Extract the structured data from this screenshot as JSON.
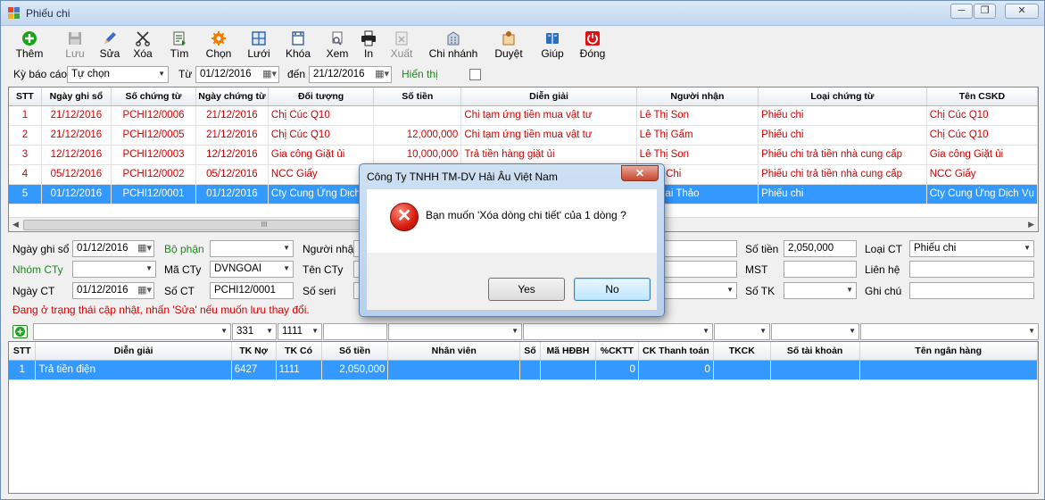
{
  "window": {
    "title": "Phiếu chi",
    "minimize": "─",
    "restore": "❐",
    "close": "✕"
  },
  "toolbar": [
    {
      "label": "Thêm",
      "icon": "add-icon",
      "color": "#1aa31a",
      "disabled": false
    },
    {
      "label": "Lưu",
      "icon": "save-icon",
      "color": "#8a8a8a",
      "disabled": true
    },
    {
      "label": "Sửa",
      "icon": "pencil-icon",
      "color": "#3a6fc4",
      "disabled": false
    },
    {
      "label": "Xóa",
      "icon": "scissors-icon",
      "color": "#333333",
      "disabled": false
    },
    {
      "label": "Tìm",
      "icon": "find-icon",
      "color": "#2b7a2b",
      "disabled": false
    },
    {
      "label": "Chọn",
      "icon": "gear-icon",
      "color": "#f07c00",
      "disabled": false
    },
    {
      "label": "Lưới",
      "icon": "grid-icon",
      "color": "#2a5fb0",
      "disabled": false
    },
    {
      "label": "Khóa",
      "icon": "lock-icon",
      "color": "#3a5fa0",
      "disabled": false
    },
    {
      "label": "Xem",
      "icon": "preview-icon",
      "color": "#5a5a8a",
      "disabled": false
    },
    {
      "label": "In",
      "icon": "printer-icon",
      "color": "#222222",
      "disabled": false
    },
    {
      "label": "Xuất",
      "icon": "export-icon",
      "color": "#9a9a9a",
      "disabled": true
    },
    {
      "label": "Chi nhánh",
      "icon": "building-icon",
      "color": "#5a6e8a",
      "disabled": false
    },
    {
      "label": "Duyệt",
      "icon": "approve-icon",
      "color": "#b06a1a",
      "disabled": false
    },
    {
      "label": "Giúp",
      "icon": "help-icon",
      "color": "#2b6fc0",
      "disabled": false
    },
    {
      "label": "Đóng",
      "icon": "power-icon",
      "color": "#e01010",
      "disabled": false
    }
  ],
  "filter": {
    "period_label": "Kỳ báo cáo",
    "period_value": "Tự chọn",
    "from_label": "Từ",
    "from_value": "01/12/2016",
    "to_label": "đến",
    "to_value": "21/12/2016",
    "show_label": "Hiển thị"
  },
  "master_grid": {
    "columns": [
      "STT",
      "Ngày ghi sổ",
      "Số chứng từ",
      "Ngày chứng từ",
      "Đối tượng",
      "Số tiền",
      "Diễn giải",
      "Người nhận",
      "Loại chứng từ",
      "Tên CSKD"
    ],
    "rows": [
      [
        "1",
        "21/12/2016",
        "PCHI12/0006",
        "21/12/2016",
        "Chị Cúc Q10",
        "",
        "Chi tạm ứng tiền mua vật tư",
        "Lê Thị Son",
        "Phiếu chi",
        "Chị Cúc Q10"
      ],
      [
        "2",
        "21/12/2016",
        "PCHI12/0005",
        "21/12/2016",
        "Chị Cúc Q10",
        "12,000,000",
        "Chi tạm ứng tiền mua vật tư",
        "Lê Thị Gấm",
        "Phiếu chi",
        "Chị Cúc Q10"
      ],
      [
        "3",
        "12/12/2016",
        "PCHI12/0003",
        "12/12/2016",
        "Gia công Giặt ủi",
        "10,000,000",
        "Trả tiền hàng giặt ủi",
        "Lê Thị Son",
        "Phiếu chi trả tiền nhà cung cấp",
        "Gia công Giặt ủi"
      ],
      [
        "4",
        "05/12/2016",
        "PCHI12/0002",
        "05/12/2016",
        "NCC Giấy",
        "",
        "",
        "hị Bé Chi",
        "Phiếu chi trả tiền nhà cung cấp",
        "NCC Giấy"
      ],
      [
        "5",
        "01/12/2016",
        "PCHI12/0001",
        "01/12/2016",
        "Cty Cung Ứng Dịch",
        "",
        "",
        "Thị Mai Thảo",
        "Phiếu chi",
        "Cty Cung Ứng Dịch Vụ"
      ]
    ]
  },
  "scroll_grip": "III",
  "form": {
    "ngay_ghi_so_label": "Ngày ghi sổ",
    "ngay_ghi_so": "01/12/2016",
    "bo_phan_label": "Bộ phận",
    "bo_phan": "",
    "nguoi_nhan_label": "Người nhận",
    "so_tien_label": "Số tiền",
    "so_tien": "2,050,000",
    "loai_ct_label": "Loại CT",
    "loai_ct": "Phiếu chi",
    "nhom_cty_label": "Nhóm CTy",
    "nhom_cty": "",
    "ma_cty_label": "Mã CTy",
    "ma_cty": "DVNGOAI",
    "ten_cty_label": "Tên CTy",
    "mst_label": "MST",
    "lien_he_label": "Liên hệ",
    "ngay_ct_label": "Ngày CT",
    "ngay_ct": "01/12/2016",
    "so_ct_label": "Số CT",
    "so_ct": "PCHI12/0001",
    "so_seri_label": "Số seri",
    "so_tk_label": "Số TK",
    "ghi_chu_label": "Ghi chú"
  },
  "status_text": "Đang ở trạng thái cập nhật, nhấn 'Sửa' nếu muốn lưu thay đổi.",
  "detail_filter": {
    "tk_no": "331",
    "tk_co": "1111"
  },
  "detail_grid": {
    "columns": [
      "STT",
      "Diễn giải",
      "TK Nợ",
      "TK Có",
      "Số tiền",
      "Nhân viên",
      "Số",
      "Mã HĐBH",
      "%CKTT",
      "CK Thanh toán",
      "TKCK",
      "Số tài khoản",
      "Tên ngân hàng"
    ],
    "rows": [
      [
        "1",
        "Trả tiền điện",
        "6427",
        "1111",
        "2,050,000",
        "",
        "",
        "",
        "0",
        "0",
        "",
        "",
        ""
      ]
    ]
  },
  "dialog": {
    "title": "Công Ty TNHH TM-DV Hải Âu Việt Nam",
    "message": "Bạn muốn 'Xóa dòng chi tiết' của 1 dòng ?",
    "yes": "Yes",
    "no": "No",
    "close": "✕",
    "error_glyph": "✕"
  },
  "colors": {
    "selected_row": "#3399ff",
    "red_text": "#d40000",
    "green_label": "#1a8a1a"
  }
}
